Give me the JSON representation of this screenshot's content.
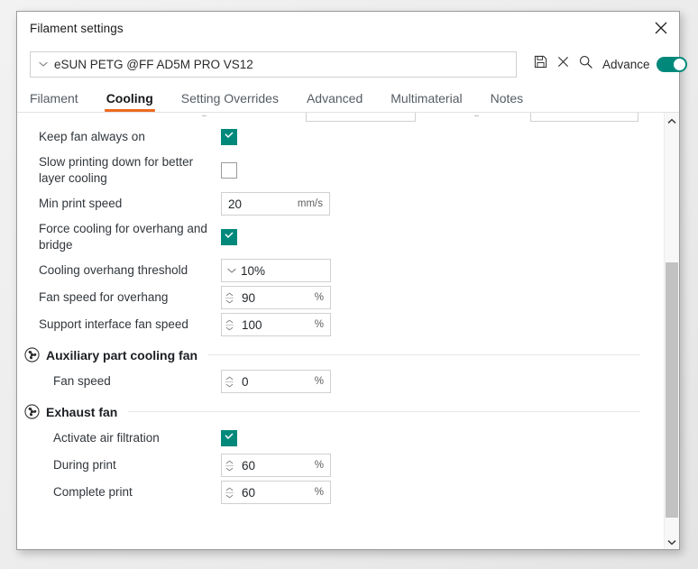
{
  "window": {
    "title": "Filament settings",
    "close_icon": "close-x-icon"
  },
  "preset": {
    "value": "eSUN PETG @FF AD5M PRO VS12",
    "dropdown_icon": "chevron-down-icon",
    "save_icon": "save-floppy-icon",
    "delete_icon": "close-x-icon",
    "search_icon": "search-magnifier-icon",
    "advance_label": "Advance",
    "advance_toggle_state": "on",
    "accent_color": "#00897b"
  },
  "tabs": {
    "active": "Cooling",
    "underline_color": "#ed6b21",
    "items": [
      {
        "label": "Filament"
      },
      {
        "label": "Cooling"
      },
      {
        "label": "Setting Overrides"
      },
      {
        "label": "Advanced"
      },
      {
        "label": "Multimaterial"
      },
      {
        "label": "Notes"
      }
    ]
  },
  "settings": {
    "keep_fan_always_on": {
      "label": "Keep fan always on",
      "checked": true
    },
    "slow_printing_down": {
      "label": "Slow printing down for better layer cooling",
      "checked": false
    },
    "min_print_speed": {
      "label": "Min print speed",
      "value": "20",
      "unit": "mm/s"
    },
    "force_cooling_overhang": {
      "label": "Force cooling for overhang and bridge",
      "checked": true
    },
    "cooling_overhang_threshold": {
      "label": "Cooling overhang threshold",
      "value": "10%",
      "dropdown_icon": "chevron-down-icon"
    },
    "fan_speed_for_overhang": {
      "label": "Fan speed for overhang",
      "value": "90",
      "unit": "%"
    },
    "support_interface_fan_speed": {
      "label": "Support interface fan speed",
      "value": "100",
      "unit": "%"
    }
  },
  "auxiliary_section": {
    "title": "Auxiliary part cooling fan",
    "icon": "fan-icon",
    "fan_speed": {
      "label": "Fan speed",
      "value": "0",
      "unit": "%"
    }
  },
  "exhaust_section": {
    "title": "Exhaust fan",
    "icon": "fan-icon",
    "activate_air_filtration": {
      "label": "Activate air filtration",
      "checked": true
    },
    "during_print": {
      "label": "During print",
      "value": "60",
      "unit": "%"
    },
    "complete_print": {
      "label": "Complete print",
      "value": "60",
      "unit": "%"
    }
  },
  "scrollbar": {
    "up_icon": "chevron-up-icon",
    "down_icon": "chevron-down-icon"
  }
}
